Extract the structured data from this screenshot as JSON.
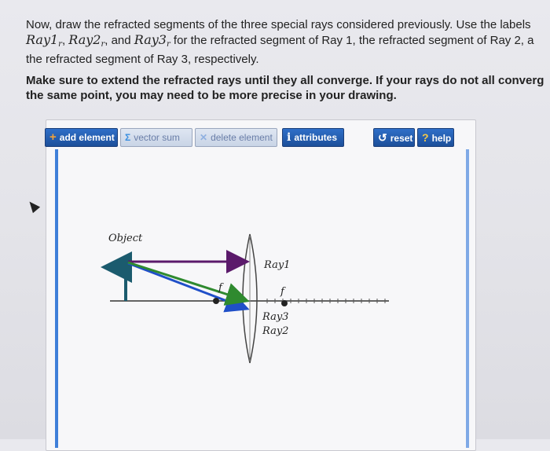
{
  "instructions": {
    "line1": "Now, draw the refracted segments of the three special rays considered previously. Use the labels",
    "label1": "Ray1",
    "sep1": ", ",
    "label2": "Ray2",
    "sep2": ", and ",
    "label3": "Ray3",
    "sub": "r",
    "line2": " for the refracted segment of Ray 1, the refracted segment of Ray 2, a",
    "line3": "the refracted segment of Ray 3, respectively."
  },
  "note": {
    "line1": "Make sure to extend the refracted rays until they all converge. If your rays do not all converg",
    "line2": "the same point, you may need to be more precise in your drawing."
  },
  "toolbar": {
    "add_label": "add element",
    "vector_sum_label": "vector sum",
    "delete_label": "delete element",
    "attributes_label": "attributes",
    "reset_label": "reset",
    "help_label": "help"
  },
  "diagram": {
    "object_label": "Object",
    "ray1_label": "Ray1",
    "ray2_label": "Ray2",
    "ray3_label": "Ray3",
    "focal_left": "f",
    "focal_right": "f",
    "colors": {
      "ray1": "#5b1a6b",
      "ray2": "#1f4fc8",
      "ray3": "#2f8a2f",
      "object": "#1b5b6e",
      "axis": "#333333"
    }
  }
}
